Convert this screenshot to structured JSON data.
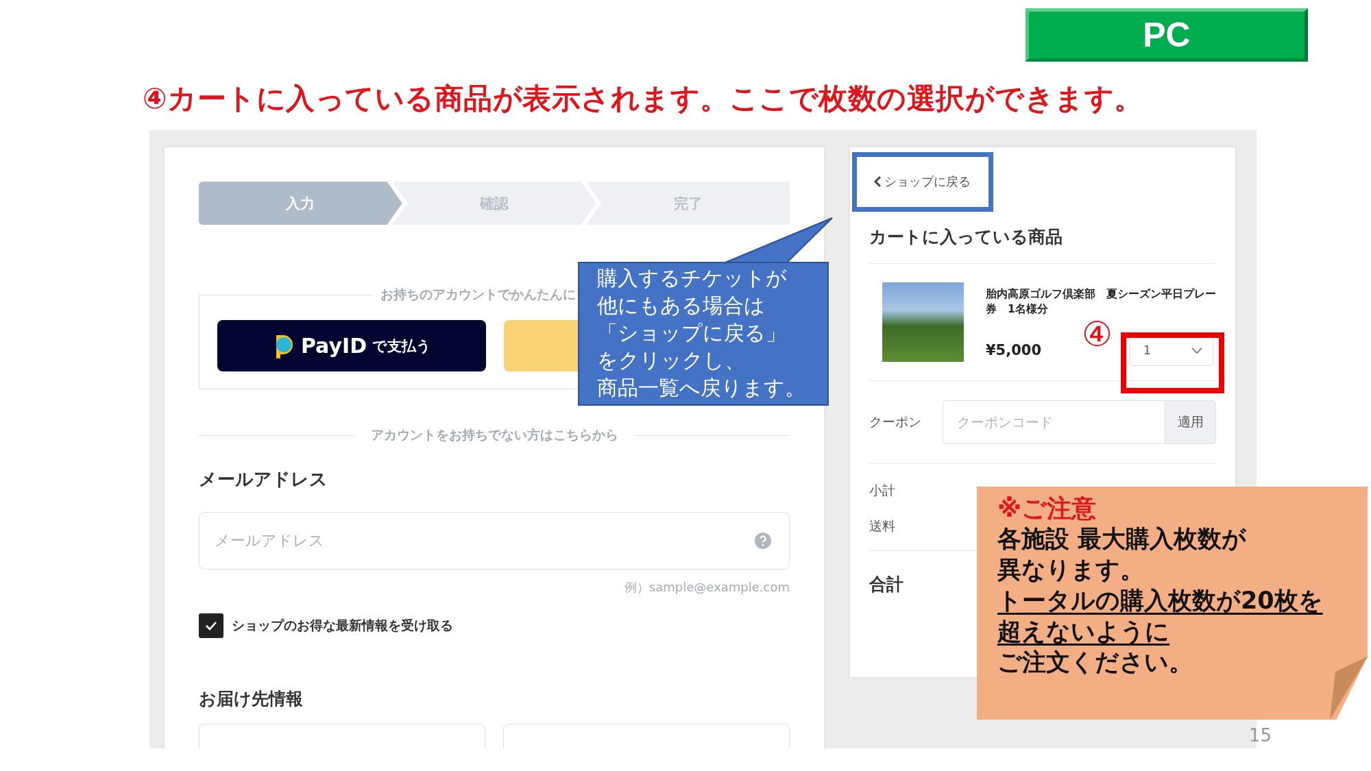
{
  "slide": {
    "badge": "PC",
    "heading": "④カートに入っている商品が表示されます。ここで枚数の選択ができます。",
    "page_number": "15"
  },
  "checkout": {
    "steps": [
      {
        "label": "入力",
        "selected": true
      },
      {
        "label": "確認",
        "selected": false
      },
      {
        "label": "完了",
        "selected": false
      }
    ],
    "account_legend": "お持ちのアカウントでかんたんに",
    "payid_button": {
      "logo_text": "PayID",
      "label": "で支払う"
    },
    "guest_divider": "アカウントをお持ちでない方はこちらから",
    "email": {
      "label": "メールアドレス",
      "placeholder": "メールアドレス",
      "example": "例）sample@example.com"
    },
    "newsletter": {
      "label": "ショップのお得な最新情報を受け取る",
      "checked": true
    },
    "delivery_heading": "お届け先情報"
  },
  "cart": {
    "back_link": "ショップに戻る",
    "heading": "カートに入っている商品",
    "items": [
      {
        "title": "胎内高原ゴルフ倶楽部　夏シーズン平日プレー券　1名様分",
        "price": "¥5,000",
        "quantity": "1"
      }
    ],
    "coupon": {
      "label": "クーポン",
      "placeholder": "クーポンコード",
      "button": "適用"
    },
    "subtotal_label": "小計",
    "shipping_label": "送料",
    "total_label": "合計"
  },
  "annotations": {
    "callout": [
      "購入するチケットが",
      "他にもある場合は",
      "「ショップに戻る」",
      "をクリックし、",
      "商品一覧へ戻ります。"
    ],
    "step_marker": "④",
    "note": {
      "title": "※ご注意",
      "lines": [
        {
          "text": "各施設 最大購入枚数が",
          "underline": false
        },
        {
          "text": "異なります。",
          "underline": false
        },
        {
          "text": "トータルの購入枚数が20枚を",
          "underline": true
        },
        {
          "text": "超えないように",
          "underline": true
        },
        {
          "text": "ご注文ください。",
          "underline": false
        }
      ]
    }
  }
}
